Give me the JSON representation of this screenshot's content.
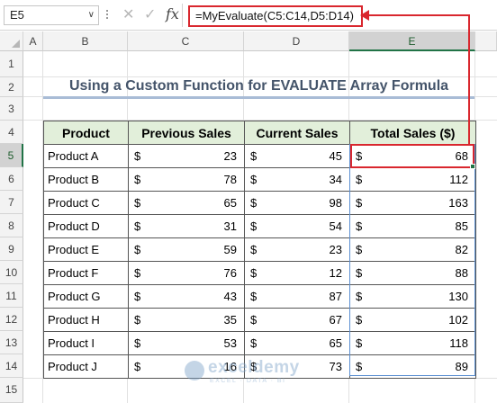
{
  "formula_bar": {
    "name_box": "E5",
    "name_box_dropdown": "∨",
    "cancel_glyph": "✕",
    "enter_glyph": "✓",
    "fx_label": "fx",
    "formula": "=MyEvaluate(C5:C14,D5:D14)"
  },
  "columns": [
    "A",
    "B",
    "C",
    "D",
    "E"
  ],
  "rows": [
    "1",
    "2",
    "3",
    "4",
    "5",
    "6",
    "7",
    "8",
    "9",
    "10",
    "11",
    "12",
    "13",
    "14",
    "15"
  ],
  "selected_column": "E",
  "selected_row": "5",
  "sheet_title": "Using a Custom Function for EVALUATE Array Formula",
  "table": {
    "headers": [
      "Product",
      "Previous Sales",
      "Current Sales",
      "Total Sales ($)"
    ],
    "currency_symbol": "$",
    "rows": [
      {
        "product": "Product A",
        "previous": "23",
        "current": "45",
        "total": "68"
      },
      {
        "product": "Product B",
        "previous": "78",
        "current": "34",
        "total": "112"
      },
      {
        "product": "Product C",
        "previous": "65",
        "current": "98",
        "total": "163"
      },
      {
        "product": "Product D",
        "previous": "31",
        "current": "54",
        "total": "85"
      },
      {
        "product": "Product E",
        "previous": "59",
        "current": "23",
        "total": "82"
      },
      {
        "product": "Product F",
        "previous": "76",
        "current": "12",
        "total": "88"
      },
      {
        "product": "Product G",
        "previous": "43",
        "current": "87",
        "total": "130"
      },
      {
        "product": "Product H",
        "previous": "35",
        "current": "67",
        "total": "102"
      },
      {
        "product": "Product I",
        "previous": "53",
        "current": "65",
        "total": "118"
      },
      {
        "product": "Product J",
        "previous": "16",
        "current": "73",
        "total": "89"
      }
    ]
  },
  "watermark": {
    "name": "exceldemy",
    "sub": "EXCEL · DATA · BI"
  },
  "colors": {
    "highlight": "#d9272e",
    "header_fill": "#e2efda",
    "title": "#44546a",
    "excel_green": "#217346"
  }
}
